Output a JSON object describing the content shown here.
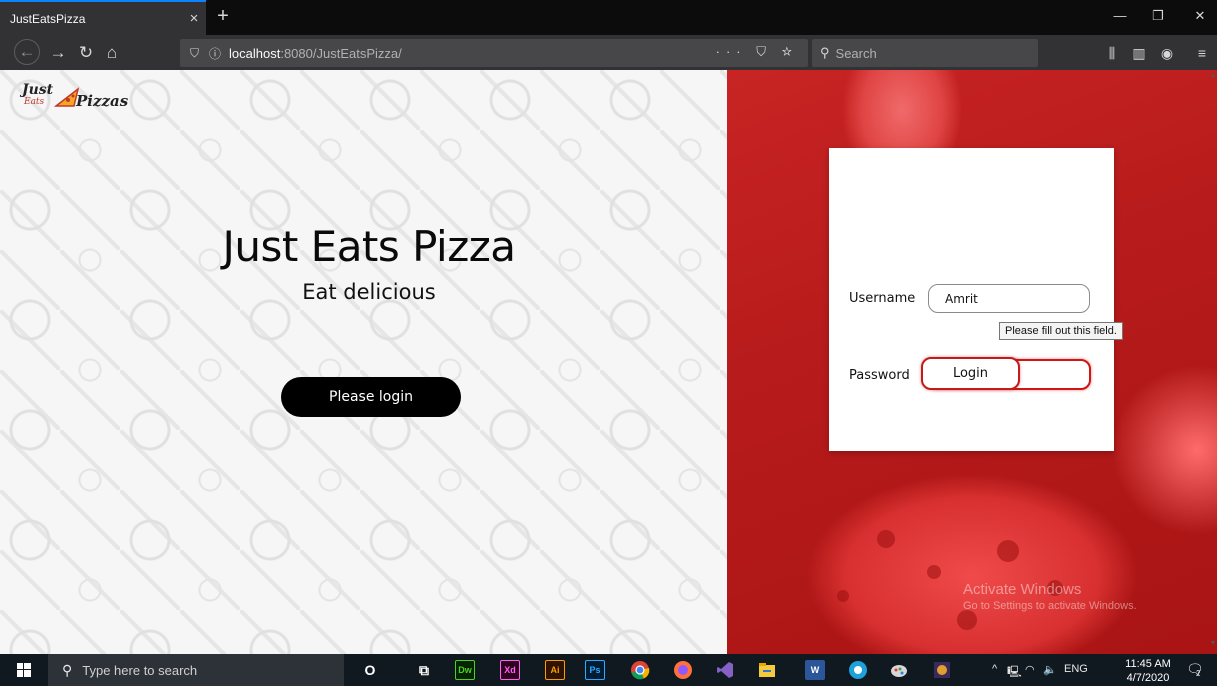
{
  "browser": {
    "tab_title": "JustEatsPizza",
    "tab_close": "×",
    "new_tab": "+",
    "url_host": "localhost",
    "url_path": ":8080/JustEatsPizza/",
    "url_actions": "··· ⛉ ☆",
    "search_placeholder": "Search",
    "window_controls": [
      "—",
      "❐",
      "✕"
    ]
  },
  "page": {
    "logo": {
      "just": "Just",
      "eats": "Eats",
      "pizzas": "Pizzas"
    },
    "hero_title": "Just Eats Pizza",
    "hero_subtitle": "Eat delicious",
    "cta_label": "Please login",
    "login": {
      "username_label": "Username",
      "username_value": "Amrit",
      "password_label": "Password",
      "password_value": "••••",
      "submit_label": "Login",
      "validation_tooltip": "Please fill out this field."
    },
    "watermark": {
      "title": "Activate Windows",
      "subtitle": "Go to Settings to activate Windows."
    }
  },
  "taskbar": {
    "search_placeholder": "Type here to search",
    "apps": [
      {
        "name": "cortana-icon",
        "glyph": "O"
      },
      {
        "name": "task-view-icon",
        "glyph": "⧉"
      },
      {
        "name": "dreamweaver-icon",
        "glyph": "Dw"
      },
      {
        "name": "xd-icon",
        "glyph": "Xd"
      },
      {
        "name": "illustrator-icon",
        "glyph": "Ai"
      },
      {
        "name": "photoshop-icon",
        "glyph": "Ps"
      }
    ],
    "lang": "ENG",
    "time": "11:45 AM",
    "date": "4/7/2020",
    "notification_count": "2"
  }
}
